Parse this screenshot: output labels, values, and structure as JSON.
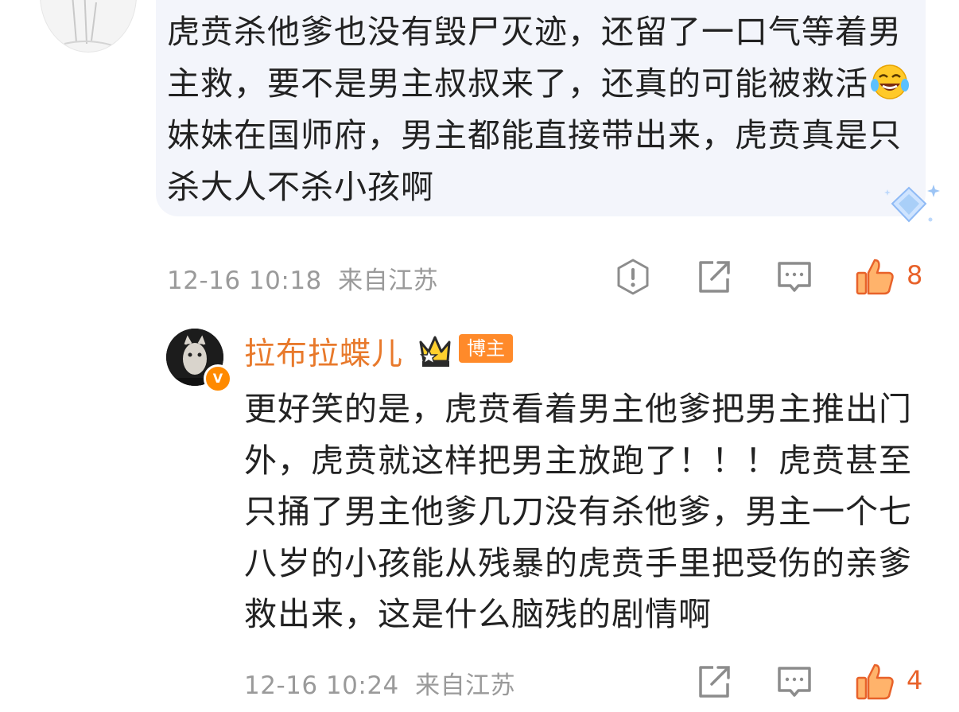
{
  "comment1": {
    "text_a": "虎贲杀他爹也没有毁尸灭迹，还留了一口气等着男主救，要不是男主叔叔来了，还真的可能被救活",
    "emoji": "laughing-tears-emoji",
    "text_b": "妹妹在国师府，男主都能直接带出来，虎贲真是只杀大人不杀小孩啊",
    "time": "12-16 10:18",
    "location": "来自江苏",
    "likes": "8"
  },
  "reply": {
    "username": "拉布拉蝶儿",
    "badge_label": "博主",
    "verified_mark": "V",
    "text": "更好笑的是，虎贲看着男主他爹把男主推出门外，虎贲就这样把男主放跑了！！！虎贲甚至只捅了男主他爹几刀没有杀他爹，男主一个七八岁的小孩能从残暴的虎贲手里把受伤的亲爹救出来，这是什么脑残的剧情啊",
    "time": "12-16 10:24",
    "location": "来自江苏",
    "likes": "4"
  },
  "colors": {
    "accent": "#e8622a",
    "username": "#e8792b",
    "meta": "#9a9a9a",
    "bubble": "#f3f5fb",
    "icon_gray": "#8c8c8c"
  }
}
